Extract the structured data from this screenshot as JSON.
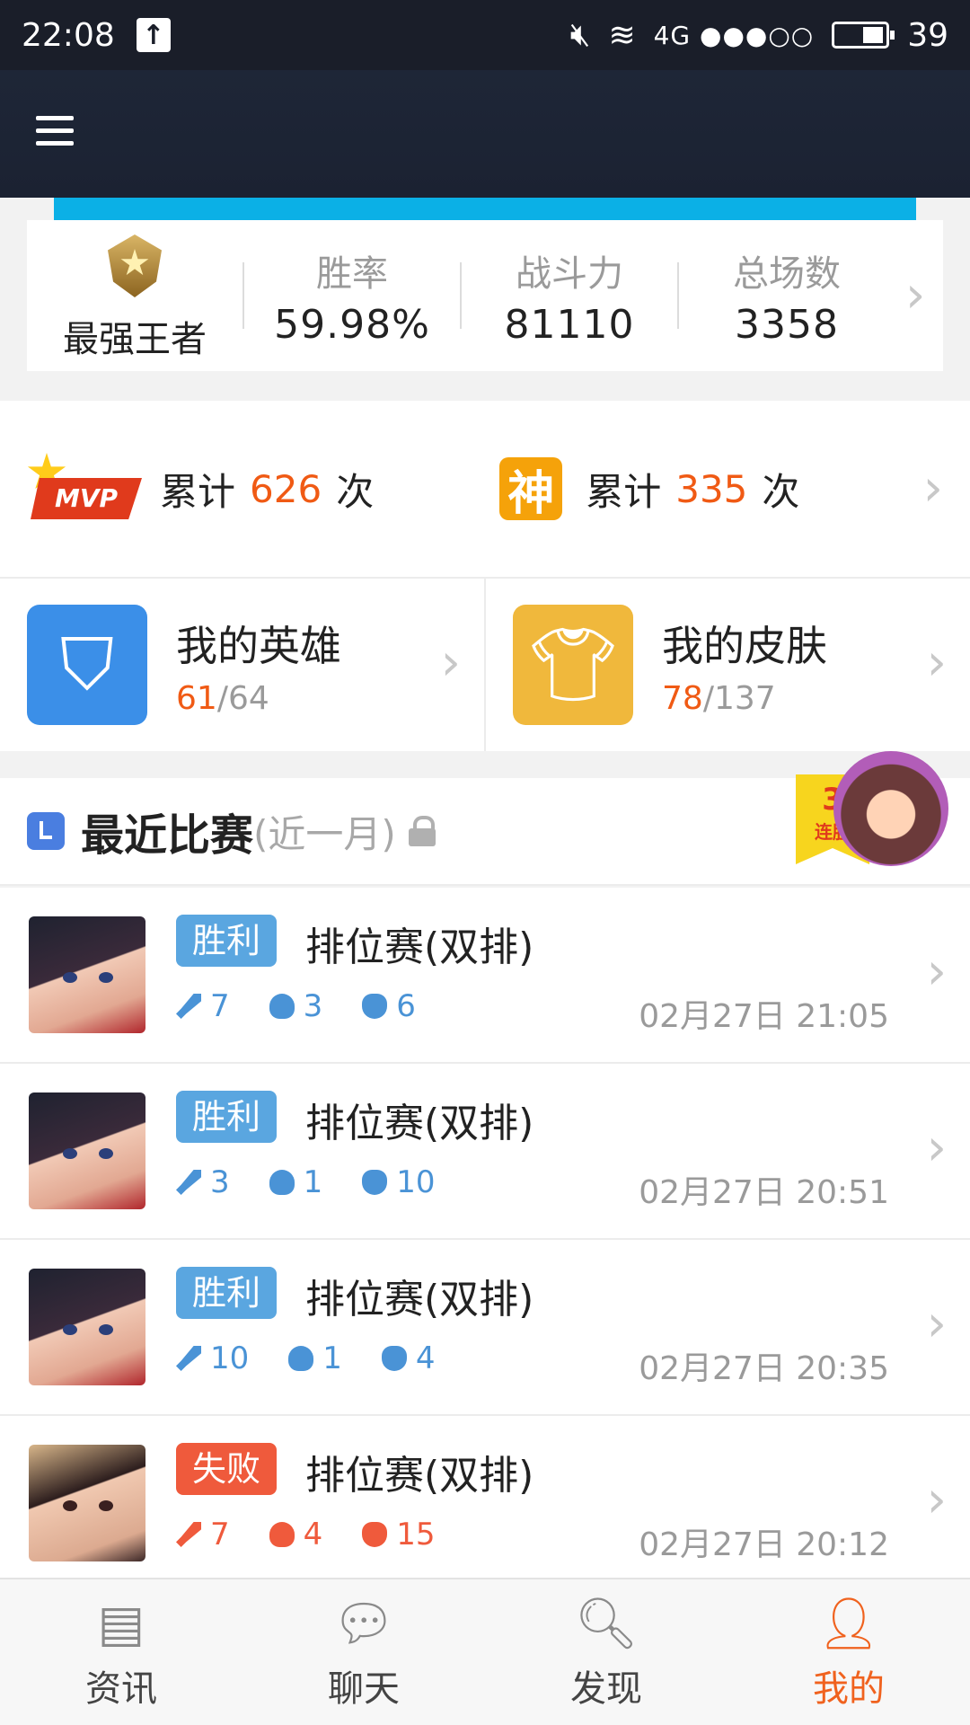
{
  "status_bar": {
    "time": "22:08",
    "network": "4G ●●●○○",
    "battery_level": "39",
    "icons": [
      "upload-icon",
      "mute-icon",
      "wifi-icon",
      "battery-icon"
    ]
  },
  "rank": {
    "name": "最强王者",
    "stats": [
      {
        "label": "胜率",
        "value": "59.98%"
      },
      {
        "label": "战斗力",
        "value": "81110"
      },
      {
        "label": "总场数",
        "value": "3358"
      }
    ]
  },
  "achievements": {
    "mvp": {
      "badge": "MVP",
      "prefix": "累计",
      "count": "626",
      "suffix": "次"
    },
    "god": {
      "badge": "神",
      "prefix": "累计",
      "count": "335",
      "suffix": "次"
    }
  },
  "collections": {
    "heroes": {
      "title": "我的英雄",
      "owned": "61",
      "total": "/64"
    },
    "skins": {
      "title": "我的皮肤",
      "owned": "78",
      "total": "/137"
    }
  },
  "recent": {
    "title": "最近比赛",
    "subtitle": "(近一月)",
    "streak_count": "3",
    "streak_label": "连胜"
  },
  "matches": [
    {
      "result": "胜利",
      "mode": "排位赛(双排)",
      "kills": "7",
      "deaths": "3",
      "assists": "6",
      "time": "02月27日  21:05"
    },
    {
      "result": "胜利",
      "mode": "排位赛(双排)",
      "kills": "3",
      "deaths": "1",
      "assists": "10",
      "time": "02月27日  20:51"
    },
    {
      "result": "胜利",
      "mode": "排位赛(双排)",
      "kills": "10",
      "deaths": "1",
      "assists": "4",
      "time": "02月27日  20:35"
    },
    {
      "result": "失败",
      "mode": "排位赛(双排)",
      "kills": "7",
      "deaths": "4",
      "assists": "15",
      "time": "02月27日  20:12"
    }
  ],
  "bottom_nav": [
    {
      "label": "资讯",
      "icon": "news-icon"
    },
    {
      "label": "聊天",
      "icon": "chat-icon"
    },
    {
      "label": "发现",
      "icon": "discover-icon"
    },
    {
      "label": "我的",
      "icon": "profile-icon",
      "active": true
    }
  ],
  "colors": {
    "accent": "#f0621e",
    "win": "#5aa6e0",
    "lose": "#ef5a3c",
    "band": "#0bb0e6"
  }
}
